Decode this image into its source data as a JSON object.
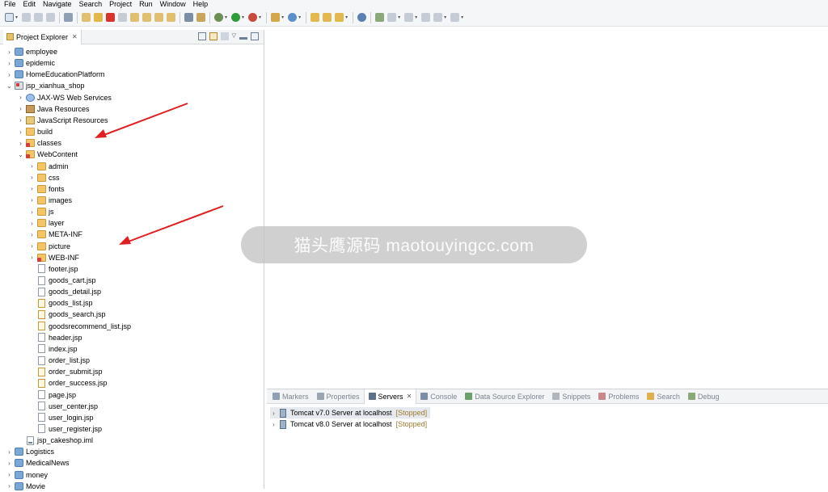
{
  "menu": [
    "File",
    "Edit",
    "Navigate",
    "Search",
    "Project",
    "Run",
    "Window",
    "Help"
  ],
  "explorer": {
    "title": "Project Explorer",
    "close": "✕"
  },
  "tree": [
    {
      "label": "employee",
      "indent": 0,
      "chev": ">",
      "icon": "project"
    },
    {
      "label": "epidemic",
      "indent": 0,
      "chev": ">",
      "icon": "project"
    },
    {
      "label": "HomeEducationPlatform",
      "indent": 0,
      "chev": ">",
      "icon": "project"
    },
    {
      "label": "jsp_xianhua_shop",
      "indent": 0,
      "chev": "v",
      "icon": "webproj"
    },
    {
      "label": "JAX-WS Web Services",
      "indent": 1,
      "chev": ">",
      "icon": "ws"
    },
    {
      "label": "Java Resources",
      "indent": 1,
      "chev": ">",
      "icon": "lib"
    },
    {
      "label": "JavaScript Resources",
      "indent": 1,
      "chev": ">",
      "icon": "js"
    },
    {
      "label": "build",
      "indent": 1,
      "chev": ">",
      "icon": "folder"
    },
    {
      "label": "classes",
      "indent": 1,
      "chev": ">",
      "icon": "folder-red"
    },
    {
      "label": "WebContent",
      "indent": 1,
      "chev": "v",
      "icon": "folder-red"
    },
    {
      "label": "admin",
      "indent": 2,
      "chev": ">",
      "icon": "folder"
    },
    {
      "label": "css",
      "indent": 2,
      "chev": ">",
      "icon": "folder"
    },
    {
      "label": "fonts",
      "indent": 2,
      "chev": ">",
      "icon": "folder"
    },
    {
      "label": "images",
      "indent": 2,
      "chev": ">",
      "icon": "folder"
    },
    {
      "label": "js",
      "indent": 2,
      "chev": ">",
      "icon": "folder"
    },
    {
      "label": "layer",
      "indent": 2,
      "chev": ">",
      "icon": "folder"
    },
    {
      "label": "META-INF",
      "indent": 2,
      "chev": ">",
      "icon": "folder"
    },
    {
      "label": "picture",
      "indent": 2,
      "chev": ">",
      "icon": "folder"
    },
    {
      "label": "WEB-INF",
      "indent": 2,
      "chev": ">",
      "icon": "folder-red"
    },
    {
      "label": "footer.jsp",
      "indent": 2,
      "chev": "",
      "icon": "file"
    },
    {
      "label": "goods_cart.jsp",
      "indent": 2,
      "chev": "",
      "icon": "file"
    },
    {
      "label": "goods_detail.jsp",
      "indent": 2,
      "chev": "",
      "icon": "file"
    },
    {
      "label": "goods_list.jsp",
      "indent": 2,
      "chev": "",
      "icon": "jsp-mod"
    },
    {
      "label": "goods_search.jsp",
      "indent": 2,
      "chev": "",
      "icon": "jsp-mod"
    },
    {
      "label": "goodsrecommend_list.jsp",
      "indent": 2,
      "chev": "",
      "icon": "jsp-mod"
    },
    {
      "label": "header.jsp",
      "indent": 2,
      "chev": "",
      "icon": "file"
    },
    {
      "label": "index.jsp",
      "indent": 2,
      "chev": "",
      "icon": "file"
    },
    {
      "label": "order_list.jsp",
      "indent": 2,
      "chev": "",
      "icon": "file"
    },
    {
      "label": "order_submit.jsp",
      "indent": 2,
      "chev": "",
      "icon": "jsp-mod"
    },
    {
      "label": "order_success.jsp",
      "indent": 2,
      "chev": "",
      "icon": "jsp-mod"
    },
    {
      "label": "page.jsp",
      "indent": 2,
      "chev": "",
      "icon": "file"
    },
    {
      "label": "user_center.jsp",
      "indent": 2,
      "chev": "",
      "icon": "file"
    },
    {
      "label": "user_login.jsp",
      "indent": 2,
      "chev": "",
      "icon": "file"
    },
    {
      "label": "user_register.jsp",
      "indent": 2,
      "chev": "",
      "icon": "file"
    },
    {
      "label": "jsp_cakeshop.iml",
      "indent": 1,
      "chev": "",
      "icon": "iml"
    },
    {
      "label": "Logistics",
      "indent": 0,
      "chev": ">",
      "icon": "project"
    },
    {
      "label": "MedicalNews",
      "indent": 0,
      "chev": ">",
      "icon": "project"
    },
    {
      "label": "money",
      "indent": 0,
      "chev": ">",
      "icon": "project"
    },
    {
      "label": "Movie",
      "indent": 0,
      "chev": ">",
      "icon": "project"
    }
  ],
  "bottom_tabs": [
    {
      "label": "Markers",
      "icon": "markers-icon",
      "color": "#8fa0b5",
      "active": false
    },
    {
      "label": "Properties",
      "icon": "properties-icon",
      "color": "#9aa5b2",
      "active": false
    },
    {
      "label": "Servers",
      "icon": "servers-icon",
      "color": "#5d7089",
      "active": true
    },
    {
      "label": "Console",
      "icon": "console-icon",
      "color": "#7d8fa6",
      "active": false
    },
    {
      "label": "Data Source Explorer",
      "icon": "data-source-icon",
      "color": "#6aa06a",
      "active": false
    },
    {
      "label": "Snippets",
      "icon": "snippets-icon",
      "color": "#b0b6be",
      "active": false
    },
    {
      "label": "Problems",
      "icon": "problems-icon",
      "color": "#c8878a",
      "active": false
    },
    {
      "label": "Search",
      "icon": "search-icon",
      "color": "#e0b050",
      "active": false
    },
    {
      "label": "Debug",
      "icon": "debug-icon",
      "color": "#8aa878",
      "active": false
    }
  ],
  "servers": [
    {
      "name": "Tomcat v7.0 Server at localhost",
      "status": "[Stopped]",
      "selected": true
    },
    {
      "name": "Tomcat v8.0 Server at localhost",
      "status": "[Stopped]",
      "selected": false
    }
  ],
  "watermark": "猫头鹰源码 maotouyingcc.com",
  "colors": {
    "accent": "#2f6fb3",
    "stopped": "#9c7b2f",
    "arrow": "#e02020"
  }
}
